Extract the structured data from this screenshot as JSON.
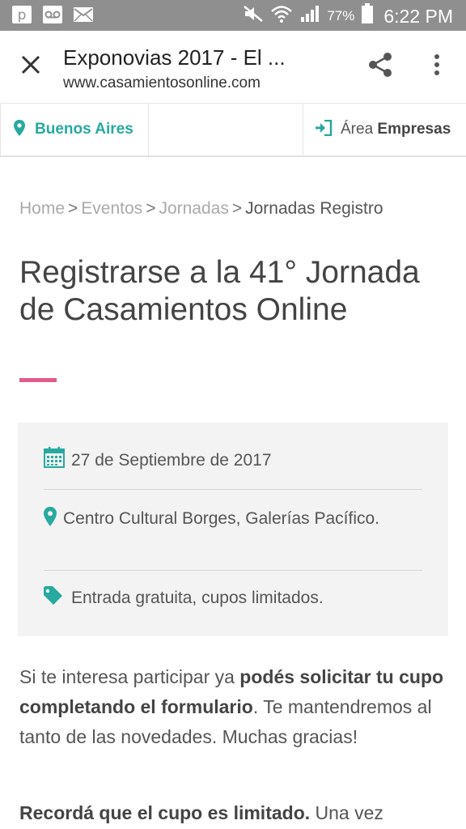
{
  "status_bar": {
    "battery_percent": "77%",
    "time": "6:22 PM"
  },
  "toolbar": {
    "title": "Exponovias 2017 - El ...",
    "url": "www.casamientosonline.com"
  },
  "site_nav": {
    "location": "Buenos Aires",
    "area_prefix": "Área",
    "area_bold": "Empresas"
  },
  "breadcrumb": {
    "items": [
      "Home",
      "Eventos",
      "Jornadas"
    ],
    "separator": ">",
    "current": "Jornadas Registro"
  },
  "page": {
    "title": "Registrarse a la 41° Jornada de Casamientos Online"
  },
  "event_info": {
    "date": "27 de Septiembre de 2017",
    "place": "Centro Cultural Borges, Galerías Pacífico.",
    "price": "Entrada gratuita, cupos limitados."
  },
  "body": {
    "p1_a": "Si te interesa participar ya ",
    "p1_bold": "podés solicitar tu cupo completando el formulario",
    "p1_b": ". Te mantendremos al tanto de las novedades. Muchas gracias!",
    "p2_bold": "Recordá que el cupo es limitado.",
    "p2_b": " Una vez"
  },
  "colors": {
    "accent_teal": "#27a9a0",
    "accent_pink": "#e05b8c",
    "status_bar": "#8f8f8f"
  },
  "icons": [
    "p-icon",
    "voicemail-icon",
    "mail-icon",
    "mute-icon",
    "wifi-icon",
    "signal-icon",
    "battery-icon",
    "close-icon",
    "share-icon",
    "more-vert-icon",
    "map-pin-icon",
    "sign-in-icon",
    "calendar-icon",
    "tag-icon"
  ]
}
